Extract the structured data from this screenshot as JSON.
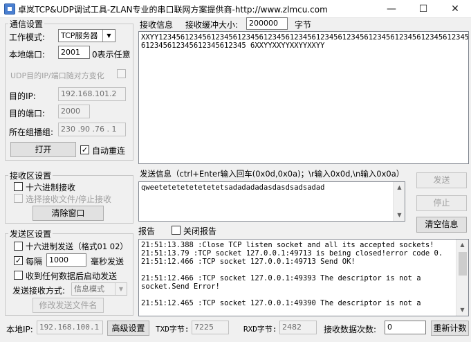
{
  "window": {
    "title": "卓岚TCP&UDP调试工具-ZLAN专业的串口联网方案提供商-http://www.zlmcu.com",
    "minimize": "—",
    "maximize": "☐",
    "close": "✕"
  },
  "comm": {
    "group_title": "通信设置",
    "mode_label": "工作模式:",
    "mode_value": "TCP服务器",
    "local_port_label": "本地端口:",
    "local_port_value": "2001",
    "any_hint": "0表示任意",
    "udp_follow_label": "UDP目的IP/端口随对方变化",
    "dest_ip_label": "目的IP:",
    "dest_ip_value": "192.168.101.2",
    "dest_port_label": "目的端口:",
    "dest_port_value": "2000",
    "group_label": "所在组播组:",
    "group_value": "230 .90 .76 . 1",
    "open_button": "打开",
    "auto_reconnect_label": "自动重连",
    "auto_reconnect_checked": "✓"
  },
  "recv_settings": {
    "group_title": "接收区设置",
    "hex_recv_label": "十六进制接收",
    "save_file_label": "选择接收文件/停止接收",
    "clear_button": "清除窗口"
  },
  "send_settings": {
    "group_title": "发送区设置",
    "hex_send_label": "十六进制发送（格式01 02）",
    "interval_prefix": "每隔",
    "interval_checked": "✓",
    "interval_value": "1000",
    "interval_unit": "毫秒发送",
    "reply_label": "收到任何数据后启动发送",
    "mode_label": "发送接收方式:",
    "mode_value": "信息模式",
    "edit_file_button": "修改发送文件名"
  },
  "receive": {
    "title": "接收信息",
    "buffer_label": "接收缓冲大小:",
    "buffer_value": "200000",
    "buffer_unit": "字节",
    "lines": [
      "XXYY1234561234561234561234561234561234561234561234561234561234561234561234561234 5",
      "612345612345612345612345 6XXYYXXYYXXYYXXYY"
    ]
  },
  "send": {
    "title": "发送信息（ctrl+Enter输入回车(0x0d,0x0a)；\\r输入0x0d,\\n输入0x0a）",
    "content": "qweetetetetetetetetsadadadadasdasdsadsadad",
    "send_button": "发送",
    "stop_button": "停止",
    "clear_button": "清空信息"
  },
  "report": {
    "title": "报告",
    "close_label": "关闭报告",
    "lines": [
      "21:51:13.388 :Close TCP listen socket and all its accepted sockets!",
      "21:51:13.79 :TCP socket 127.0.0.1:49713 is being closed!error code 0.",
      "21:51:12.466 :TCP socket 127.0.0.1:49713 Send OK!",
      "",
      "21:51:12.466 :TCP socket 127.0.0.1:49393 The descriptor is not a",
      "socket.Send Error!",
      "",
      "21:51:12.465 :TCP socket 127.0.0.1:49390 The descriptor is not a"
    ]
  },
  "status": {
    "local_ip_label": "本地IP:",
    "local_ip_value": "192.168.100.1",
    "advanced_button": "高级设置",
    "txd_label": "TXD字节:",
    "txd_value": "7225",
    "rxd_label": "RXD字节:",
    "rxd_value": "2482",
    "recv_count_label": "接收数据次数:",
    "recv_count_value": "0",
    "recount_button": "重新计数"
  }
}
